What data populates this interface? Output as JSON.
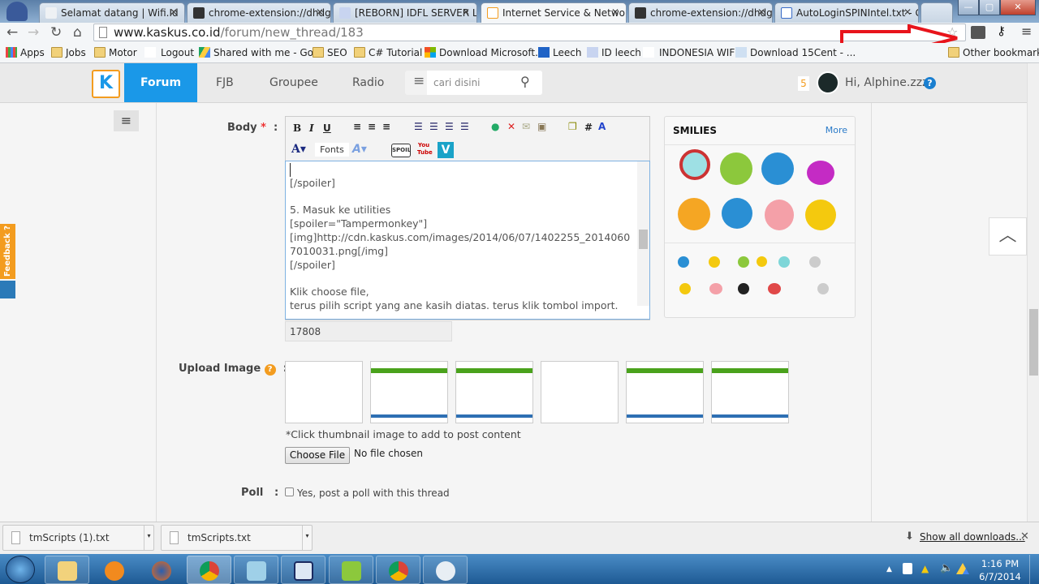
{
  "browser": {
    "tabs": [
      {
        "title": "Selamat datang | Wifi.Id",
        "active": false
      },
      {
        "title": "chrome-extension://dhdg",
        "active": false
      },
      {
        "title": "[REBORN] IDFL SERVER LE",
        "active": false
      },
      {
        "title": "Internet Service & Networ",
        "active": true
      },
      {
        "title": "chrome-extension://dhdg",
        "active": false
      },
      {
        "title": "AutoLoginSPINIntel.txt - G",
        "active": false
      }
    ],
    "url_host": "www.kaskus.co.id",
    "url_path": "/forum/new_thread/183",
    "bookmarks": [
      "Apps",
      "Jobs",
      "Motor",
      "Logout",
      "Shared with me - Go...",
      "SEO",
      "C# Tutorial",
      "Download Microsoft...",
      "Leech",
      "ID leech",
      "INDONESIA WIFI",
      "Download 15Cent - ..."
    ],
    "other_bookmarks": "Other bookmarks",
    "annotation_arrow_color": "#e8141b"
  },
  "site": {
    "brand_color": "#1a98e8",
    "nav": [
      "Forum",
      "FJB",
      "Groupee",
      "Radio"
    ],
    "active_nav": "Forum",
    "search_placeholder": "cari disini",
    "notification_count": "5",
    "greeting": "Hi, Alphine.zzz",
    "feedback_label": "Feedback ?"
  },
  "form": {
    "body_label": "Body",
    "required_mark": "*",
    "colon": ":",
    "toolbar": {
      "bold": "B",
      "italic": "I",
      "underline": "U",
      "fonts": "Fonts",
      "hash": "#",
      "spoiler": "SPOIL",
      "youtube": "You Tube",
      "vimeo": "V"
    },
    "body_lines": [
      "",
      "[/spoiler]",
      "",
      "5. Masuk ke utilities",
      "[spoiler=\"Tampermonkey\"]",
      "[img]http://cdn.kaskus.com/images/2014/06/07/1402255_20140607010031.png[/img]",
      "[/spoiler]",
      "",
      "Klik choose file,",
      "terus pilih script yang ane kasih diatas. terus klik tombol import."
    ],
    "char_count": "17808",
    "smilies_title": "SMILIES",
    "smilies_more": "More",
    "upload_label": "Upload Image",
    "upload_hint": "*Click thumbnail image to add to post content",
    "choose_file": "Choose File",
    "no_file": "No file chosen",
    "poll_label": "Poll",
    "poll_checkbox": "Yes, post a poll with this thread",
    "poll_checked": false
  },
  "downloads": {
    "items": [
      "tmScripts (1).txt",
      "tmScripts.txt"
    ],
    "show_all": "Show all downloads..."
  },
  "taskbar": {
    "time": "1:16 PM",
    "date": "6/7/2014"
  }
}
